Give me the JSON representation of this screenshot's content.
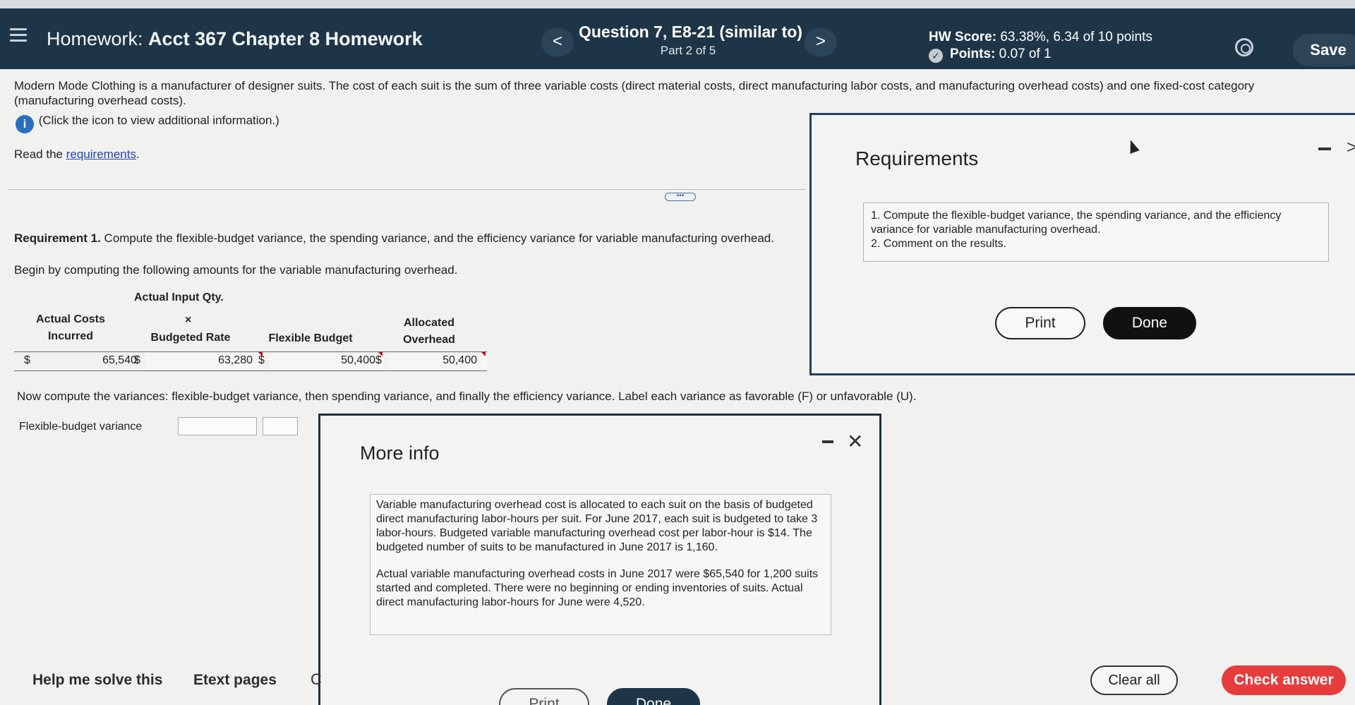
{
  "header": {
    "title_prefix": "Homework:",
    "title": "Acct 367 Chapter 8 Homework",
    "prev_icon": "<",
    "next_icon": ">",
    "question_title": "Question 7, E8-21 (similar to)",
    "question_part": "Part 2 of 5",
    "score_label": "HW Score:",
    "score_value": "63.38%, 6.34 of 10 points",
    "points_label": "Points:",
    "points_value": "0.07 of 1",
    "save_label": "Save"
  },
  "problem": {
    "intro": "Modern Mode Clothing is a manufacturer of designer suits. The cost of each suit is the sum of three variable costs (direct material costs, direct manufacturing labor costs, and manufacturing overhead costs) and one fixed-cost category (manufacturing overhead costs).",
    "info_icon": "i",
    "info_text": "(Click the icon to view additional information.)",
    "read_prefix": "Read the ",
    "read_link": "requirements",
    "read_suffix": ".",
    "more_dots": "•••",
    "requirement_label": "Requirement 1.",
    "requirement_text": " Compute the flexible-budget variance, the spending variance, and the efficiency variance for variable manufacturing overhead.",
    "begin_text": "Begin by computing the following amounts for the variable manufacturing overhead.",
    "table": {
      "header_actual_input": "Actual Input Qty.",
      "header_times": "×",
      "header_budgeted_rate": "Budgeted Rate",
      "header_actual_costs_1": "Actual Costs",
      "header_actual_costs_2": "Incurred",
      "header_flexible_budget": "Flexible Budget",
      "header_allocated_1": "Allocated",
      "header_allocated_2": "Overhead",
      "currency": "$",
      "actual_costs": "65,540",
      "budgeted_rate_amount": "63,280",
      "flexible_budget": "50,400",
      "allocated_overhead": "50,400"
    },
    "variances_text": "Now compute the variances: flexible-budget variance, then spending variance, and finally the efficiency variance. Label each variance as favorable (F) or unfavorable (U).",
    "fbv_label": "Flexible-budget variance",
    "fbv_value": "",
    "fbv_selection": ""
  },
  "requirements_popup": {
    "title": "Requirements",
    "item1": "1. Compute the flexible-budget variance, the spending variance, and the efficiency variance for variable manufacturing overhead.",
    "item2": "2. Comment on the results.",
    "print_label": "Print",
    "done_label": "Done",
    "chevron_icon": ">"
  },
  "more_info_popup": {
    "title": "More info",
    "close_icon": "✕",
    "para1": "Variable manufacturing overhead cost is allocated to each suit on the basis of budgeted direct manufacturing labor-hours per suit. For June 2017, each suit is budgeted to take 3 labor-hours. Budgeted variable manufacturing overhead cost per labor-hour is $14. The budgeted number of suits to be manufactured in June 2017 is 1,160.",
    "para2": "Actual variable manufacturing overhead costs in June 2017 were $65,540 for 1,200 suits started and completed. There were no beginning or ending inventories of suits. Actual direct manufacturing labor-hours for June were 4,520.",
    "print_label": "Print",
    "done_label": "Done"
  },
  "footer": {
    "help_label": "Help me solve this",
    "etext_label": "Etext pages",
    "partial_label": "C",
    "clear_label": "Clear all",
    "check_label": "Check answer"
  },
  "colors": {
    "header_bg": "#1e3548",
    "check_answer": "#e63c3c",
    "link": "#2246b3",
    "info_icon": "#2a6ebf"
  }
}
